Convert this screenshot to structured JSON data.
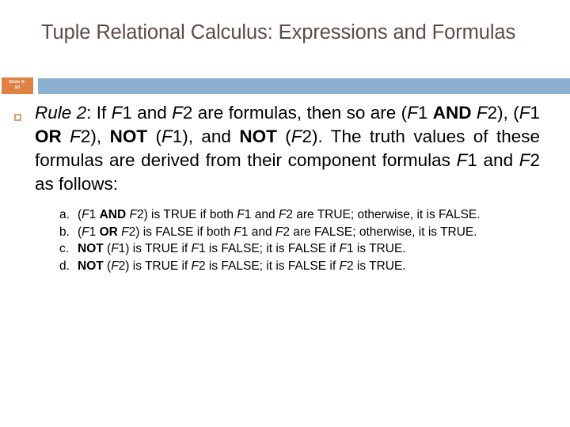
{
  "slide": {
    "title": "Tuple Relational Calculus: Expressions and Formulas",
    "badge": {
      "line1": "Slide 6-",
      "line2": "50"
    },
    "colors": {
      "title_text": "#5d4b43",
      "band_blue": "#8cb1d0",
      "badge_orange": "#e08244",
      "bullet_border": "#d8a070",
      "body_text": "#000000",
      "background": "#ffffff"
    },
    "body": {
      "bullet_marker": "square-outline-bullet",
      "rule": {
        "label": "Rule",
        "number": " 2",
        "colon": ": If ",
        "f1_a": "F",
        "f1_a_num": "1",
        "and_word": " and ",
        "f2_a": "F",
        "f2_a_num": "2",
        "mid1": " are formulas, then so are (",
        "f1_b": "F",
        "f1_b_num": "1 ",
        "op_and": "AND",
        "sp1": " ",
        "f2_b": "F",
        "f2_b_num": "2",
        "mid2": "), (",
        "f1_c": "F",
        "f1_c_num": "1 ",
        "op_or": "OR",
        "sp2": " ",
        "f2_c": "F",
        "f2_c_num": "2",
        "mid3": "), ",
        "op_not_1": "NOT",
        "mid4": " (",
        "f1_d": "F",
        "f1_d_num": "1",
        "mid5": "), and ",
        "op_not_2": "NOT",
        "mid6": " (",
        "f2_d": "F",
        "f2_d_num": "2",
        "tail": "). The truth values of these formulas are derived from their component formulas ",
        "f1_e": "F",
        "f1_e_num": "1",
        "and_word2": " and ",
        "f2_e": "F",
        "f2_e_num": "2",
        "tail2": " as follows:"
      },
      "sub_items": [
        {
          "marker": "a.",
          "p1": "(",
          "v1": "F",
          "v1n": "1 ",
          "op": "AND",
          "p2": " ",
          "v2": "F",
          "v2n": "2",
          "p3": ") is TRUE if both ",
          "v3": "F",
          "v3n": "1",
          "p4": " and ",
          "v4": "F",
          "v4n": "2",
          "p5": " are TRUE; otherwise, it is FALSE."
        },
        {
          "marker": "b.",
          "p1": "(",
          "v1": "F",
          "v1n": "1 ",
          "op": "OR",
          "p2": " ",
          "v2": "F",
          "v2n": "2",
          "p3": ") is FALSE if both ",
          "v3": "F",
          "v3n": "1",
          "p4": " and ",
          "v4": "F",
          "v4n": "2",
          "p5": " are FALSE; otherwise, it is TRUE."
        },
        {
          "marker": "c.",
          "p1": "",
          "op": "NOT",
          "p2": " (",
          "v2": "F",
          "v2n": "1",
          "p3": ") is TRUE if ",
          "v3": "F",
          "v3n": "1",
          "p4": " is FALSE; it is FALSE if ",
          "v4": "F",
          "v4n": "1",
          "p5": " is TRUE."
        },
        {
          "marker": "d.",
          "p1": "",
          "op": "NOT",
          "p2": " (",
          "v2": "F",
          "v2n": "2",
          "p3": ") is TRUE if ",
          "v3": "F",
          "v3n": "2",
          "p4": " is FALSE; it is FALSE if ",
          "v4": "F",
          "v4n": "2",
          "p5": " is TRUE."
        }
      ]
    }
  }
}
